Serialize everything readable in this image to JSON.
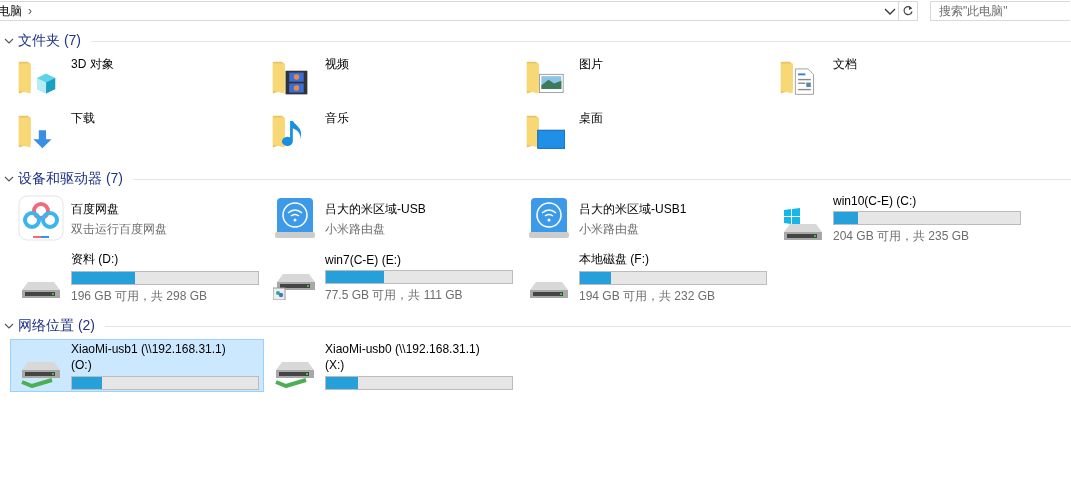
{
  "address_bar": {
    "breadcrumb": "电脑",
    "separator": "›"
  },
  "search": {
    "placeholder": "搜索\"此电脑\""
  },
  "groups": [
    {
      "title": "文件夹 (7)",
      "expanded": true,
      "items": [
        {
          "kind": "cube-folder",
          "name": "3D 对象",
          "selected": false
        },
        {
          "kind": "film-folder",
          "name": "视频",
          "selected": false
        },
        {
          "kind": "photo-folder",
          "name": "图片",
          "selected": false
        },
        {
          "kind": "document-folder",
          "name": "文档",
          "selected": false
        },
        {
          "kind": "download-folder",
          "name": "下载",
          "selected": false
        },
        {
          "kind": "note-folder",
          "name": "音乐",
          "selected": false
        },
        {
          "kind": "screen-folder",
          "name": "桌面",
          "selected": false
        }
      ]
    },
    {
      "title": "设备和驱动器 (7)",
      "expanded": true,
      "items": [
        {
          "kind": "cloud-app",
          "name": "百度网盘",
          "subtitle": "双击运行百度网盘",
          "selected": false
        },
        {
          "kind": "wifi-disk",
          "name": "吕大的米区域-USB",
          "subtitle": "小米路由盘",
          "selected": false
        },
        {
          "kind": "wifi-disk",
          "name": "吕大的米区域-USB1",
          "subtitle": "小米路由盘",
          "selected": false
        },
        {
          "kind": "windows-drive",
          "name": "win10(C-E) (C:)",
          "level": 0.13,
          "reading": "204 GB 可用，共 235 GB",
          "selected": false
        },
        {
          "kind": "drive",
          "name": "资料 (D:)",
          "level": 0.34,
          "reading": "196 GB 可用，共 298 GB",
          "selected": false
        },
        {
          "kind": "shared-drive",
          "name": "win7(C-E) (E:)",
          "level": 0.31,
          "reading": "77.5 GB 可用，共 111 GB",
          "selected": false
        },
        {
          "kind": "drive",
          "name": "本地磁盘 (F:)",
          "level": 0.165,
          "reading": "194 GB 可用，共 232 GB",
          "selected": false
        }
      ]
    },
    {
      "title": "网络位置 (2)",
      "expanded": true,
      "items": [
        {
          "kind": "network-drive",
          "name": "XiaoMi-usb1 (\\\\192.168.31.1) (O:)",
          "level": 0.16,
          "selected": true
        },
        {
          "kind": "network-drive",
          "name": "XiaoMi-usb0 (\\\\192.168.31.1) (X:)",
          "level": 0.17,
          "selected": false
        }
      ]
    }
  ]
}
